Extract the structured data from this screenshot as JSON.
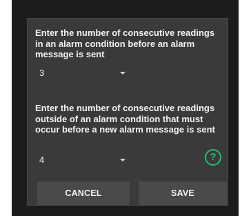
{
  "dialog": {
    "prompt_1": "Enter the number of consecutive readings in an alarm condition before an alarm message is sent",
    "select_1_value": "3",
    "prompt_2": "Enter the number of consecutive readings outside of an alarm condition that must occur before a new alarm message is sent",
    "select_2_value": "4",
    "help_icon": "?",
    "cancel_label": "CANCEL",
    "save_label": "SAVE"
  },
  "colors": {
    "dialog_bg": "#3a3a3a",
    "button_bg": "#4a4a4a",
    "accent_help": "#1fbf74",
    "text": "#f2f2f2"
  },
  "icons": {
    "dropdown": "caret-down-icon",
    "help": "question-circle-icon"
  }
}
